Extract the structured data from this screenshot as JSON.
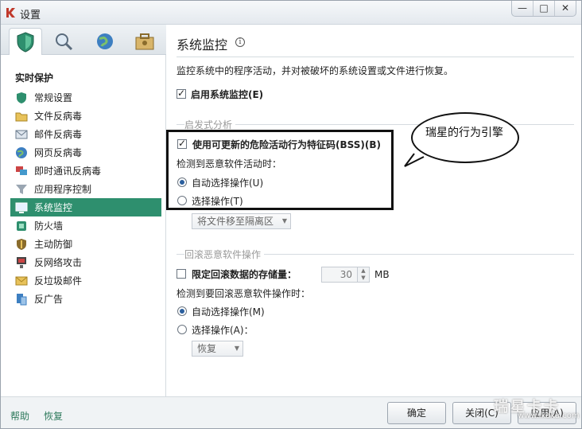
{
  "window": {
    "title": "设置",
    "minimize": "—",
    "maximize": "□",
    "close": "✕"
  },
  "sidebar": {
    "section_title": "实时保护",
    "items": [
      {
        "label": "常规设置",
        "icon": "shield-icon"
      },
      {
        "label": "文件反病毒",
        "icon": "folder-icon"
      },
      {
        "label": "邮件反病毒",
        "icon": "mail-icon"
      },
      {
        "label": "网页反病毒",
        "icon": "globe-icon"
      },
      {
        "label": "即时通讯反病毒",
        "icon": "chat-icon"
      },
      {
        "label": "应用程序控制",
        "icon": "filter-icon"
      },
      {
        "label": "系统监控",
        "icon": "monitor-icon",
        "active": true
      },
      {
        "label": "防火墙",
        "icon": "firewall-icon"
      },
      {
        "label": "主动防御",
        "icon": "defense-icon"
      },
      {
        "label": "反网络攻击",
        "icon": "network-icon"
      },
      {
        "label": "反垃圾邮件",
        "icon": "spam-icon"
      },
      {
        "label": "反广告",
        "icon": "ad-icon"
      }
    ]
  },
  "main": {
    "title": "系统监控",
    "description": "监控系统中的程序活动，并对被破坏的系统设置或文件进行恢复。",
    "enable_label": "启用系统监控(E)",
    "heuristic_group": "启发式分析",
    "bss_label": "使用可更新的危险活动行为特征码(BSS)(B)",
    "detect_label": "检测到恶意软件活动时：",
    "auto_label": "自动选择操作(U)",
    "select_label": "选择操作(T)",
    "action_select": "将文件移至隔离区",
    "rollback_group": "回滚恶意软件操作",
    "limit_label": "限定回滚数据的存储量：",
    "limit_value": "30",
    "limit_unit": "MB",
    "rollback_detect_label": "检测到要回滚恶意软件操作时：",
    "rollback_auto_label": "自动选择操作(M)",
    "rollback_select_label": "选择操作(A)：",
    "rollback_action_select": "恢复"
  },
  "footer": {
    "help": "帮助",
    "restore": "恢复",
    "ok": "确定",
    "close": "关闭(C)",
    "apply": "应用(A)"
  },
  "annotation": {
    "bubble_text": "瑞星的行为引擎"
  },
  "watermark": {
    "line1": "瑞星卡卡",
    "line2": "www.ikaka.com"
  },
  "colors": {
    "accent": "#2e8f6e",
    "link": "#2e7a5c"
  }
}
